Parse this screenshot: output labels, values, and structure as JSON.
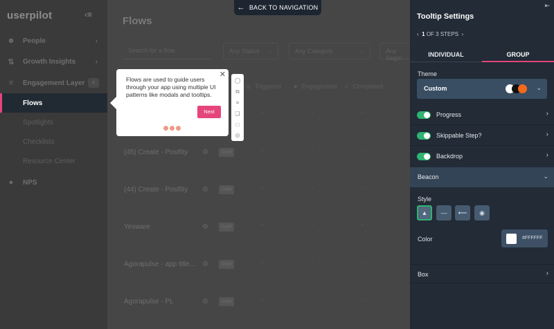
{
  "sidebar": {
    "logo": "userpilot",
    "nav": [
      {
        "label": "People",
        "icon": "people-icon"
      },
      {
        "label": "Growth Insights",
        "icon": "chart-icon"
      },
      {
        "label": "Engagement Layer",
        "icon": "layers-icon"
      }
    ],
    "active": "Flows",
    "sub": [
      "Spotlights",
      "Checklists",
      "Resource Center"
    ],
    "bottom": "NPS"
  },
  "main": {
    "title": "Flows",
    "search_placeholder": "Search for a flow",
    "filters": [
      "Any Status",
      "Any Category",
      "Any Segm"
    ],
    "columns": [
      "Triggered",
      "Engagement",
      "Completed"
    ],
    "rows": [
      {
        "name": "(45) Create - Postfity",
        "badge": "Draft"
      },
      {
        "name": "(44) Create - Postfity",
        "badge": "Draft"
      },
      {
        "name": "Yesware",
        "badge": "Draft"
      },
      {
        "name": "Agorapulse - app title...",
        "badge": "Draft"
      },
      {
        "name": "Agorapulse - PL",
        "badge": "Draft"
      }
    ],
    "dash": "-"
  },
  "back_nav": {
    "label": "BACK TO NAVIGATION"
  },
  "tooltip": {
    "text": "Flows are used to guide users through your app using multiple UI patterns like modals and tooltips.",
    "next": "Next"
  },
  "panel": {
    "title": "Tooltip Settings",
    "step_current": "1",
    "step_rest": "OF 3 STEPS",
    "tabs": [
      "INDIVIDUAL",
      "GROUP"
    ],
    "theme_label": "Theme",
    "theme_value": "Custom",
    "theme_colors": [
      "#ffffff",
      "#111111",
      "#f26a1b"
    ],
    "toggles": [
      "Progress",
      "Skippable Step?",
      "Backdrop"
    ],
    "beacon": "Beacon",
    "style_label": "Style",
    "color_label": "Color",
    "color_hex": "#FFFFFF",
    "box": "Box"
  }
}
